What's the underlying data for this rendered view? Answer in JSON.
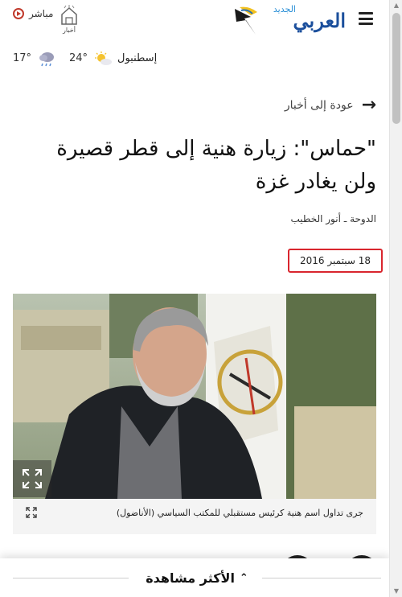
{
  "header": {
    "logo_text": "العربي",
    "logo_sub": "الجديد",
    "live_label": "مباشر",
    "akhbar_label": "أخبار"
  },
  "weather": {
    "city": "إسطنبول",
    "temp_today": "24°",
    "temp_next": "17°"
  },
  "article": {
    "back_label": "عودة إلى أخبار",
    "title": "\"حماس\": زيارة هنية إلى قطر قصيرة ولن يغادر غزة",
    "byline": "الدوحة ـ أنور الخطيب",
    "date": "18 سبتمبر 2016",
    "caption": "جرى تداول اسم هنية كرئيس مستقبلي للمكتب السياسي (الأناضول)"
  },
  "bottom": {
    "most_viewed_label": "الأكثر مشاهدة"
  },
  "colors": {
    "accent_red": "#d9262e",
    "live_red": "#c0392b"
  }
}
